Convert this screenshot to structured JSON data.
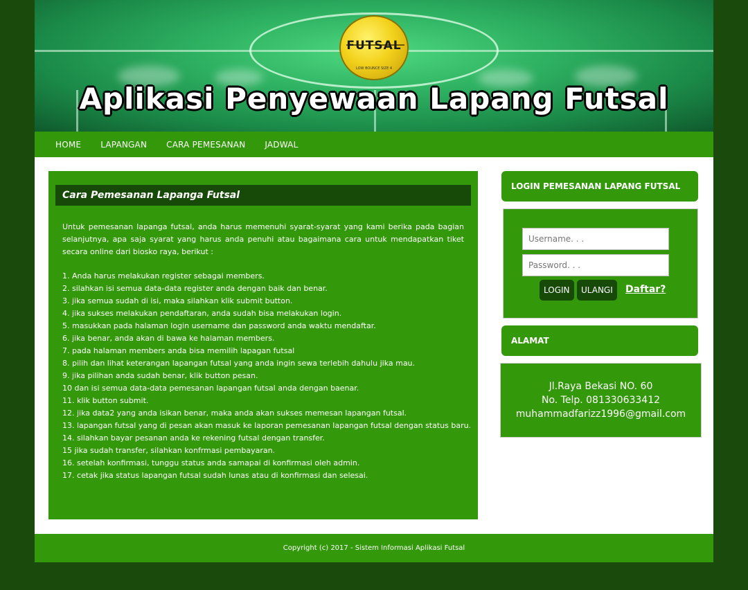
{
  "header": {
    "title": "Aplikasi Penyewaan Lapang Futsal",
    "ball_label": "FUTSAL",
    "ball_sub": "LOW BOUNCE SIZE 4"
  },
  "nav": {
    "items": [
      "HOME",
      "LAPANGAN",
      "CARA PEMESANAN",
      "JADWAL"
    ]
  },
  "main": {
    "title": "Cara Pemesanan Lapanga Futsal",
    "intro": "Untuk pemesanan lapanga futsal, anda harus memenuhi syarat-syarat yang kami berika pada bagian selanjutnya, apa saja syarat yang harus anda penuhi atau bagaimana cara untuk mendapatkan tiket secara online dari biosko raya, berikut :",
    "steps": [
      "1. Anda harus melakukan register sebagai members.",
      "2. silahkan isi semua data-data register anda dengan baik dan benar.",
      "3. jika semua sudah di isi, maka silahkan klik submit button.",
      "4. jika sukses melakukan pendaftaran, anda sudah bisa melakukan login.",
      "5. masukkan pada halaman login username dan password anda waktu mendaftar.",
      "6. jika benar, anda akan di bawa ke halaman members.",
      "7. pada halaman members anda bisa memilih lapagan futsal",
      "8. pilih dan lihat keterangan lapangan futsal yang anda ingin sewa terlebih dahulu jika mau.",
      "9. jika pilihan anda sudah benar, klik button pesan.",
      "10 dan isi semua data-data pemesanan lapangan futsal anda dengan baenar.",
      "11. klik button submit.",
      "12. jika data2 yang anda isikan benar, maka anda akan sukses memesan lapangan futsal.",
      "13. lapangan futsal yang di pesan akan masuk ke laporan pemesanan lapangan futsal dengan status baru.",
      "14. silahkan bayar pesanan anda ke rekening futsal dengan transfer.",
      "15 jika sudah transfer, silahkan konfrmasi pembayaran.",
      "16. setelah konfirmasi, tunggu status anda samapai di konfirmasi oleh admin.",
      "17. cetak jika status lapangan futsal sudah lunas atau di konfirmasi dan selesai."
    ]
  },
  "login": {
    "heading": "LOGIN PEMESANAN LAPANG FUTSAL",
    "username_placeholder": "Username. . .",
    "password_placeholder": "Password. . .",
    "login_label": "LOGIN",
    "reset_label": "ULANGI",
    "register_label": "Daftar?"
  },
  "alamat": {
    "heading": "ALAMAT",
    "address": "Jl.Raya Bekasi NO. 60",
    "phone": "No. Telp. 081330633412",
    "email": "muhammadfarizz1996@gmail.com"
  },
  "footer": {
    "copyright": "Copyright (c) 2017 - Sistem Informasi Aplikasi Futsal"
  },
  "colors": {
    "primary_green": "#33990b",
    "dark_green": "#174a08",
    "page_bg": "#1a4a0c"
  }
}
